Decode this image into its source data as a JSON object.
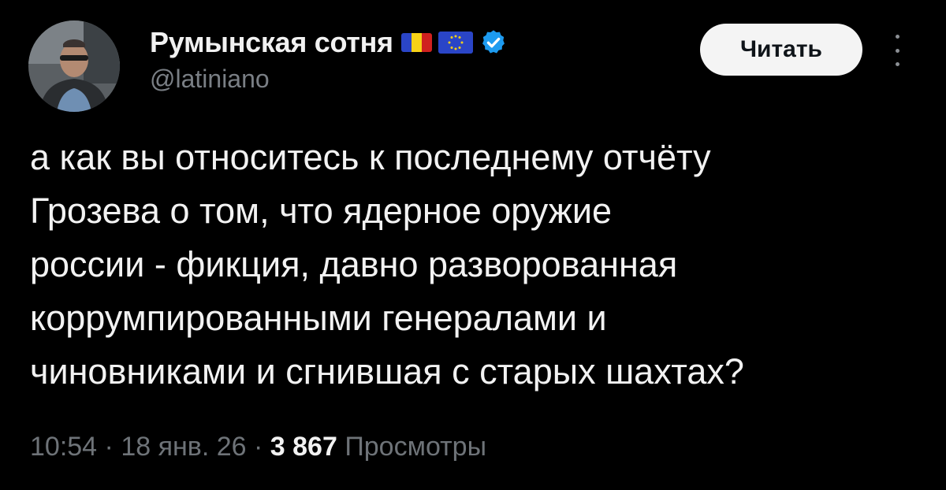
{
  "author": {
    "display_name": "Румынская сотня",
    "handle": "@latiniano",
    "badges": [
      "romania-flag",
      "eu-flag",
      "verified-badge"
    ]
  },
  "actions": {
    "follow_label": "Читать",
    "more_icon": "more-vertical-icon"
  },
  "tweet": {
    "lines": [
      "а как вы относитесь к последнему отчёту",
      "Грозева о том, что ядерное оружие",
      "россии - фикция, давно разворованная",
      "коррумпированными генералами и",
      "чиновниками и сгнившая с старых шахтах?"
    ]
  },
  "meta": {
    "time": "10:54",
    "separator": " · ",
    "date": "18 янв. 26",
    "views_count": "3 867",
    "views_label": "Просмотры"
  },
  "colors": {
    "background": "#000000",
    "text": "#e7e9ea",
    "muted": "#6e7378",
    "verified": "#1d9bf0",
    "follow_bg": "#f4f4f4"
  }
}
